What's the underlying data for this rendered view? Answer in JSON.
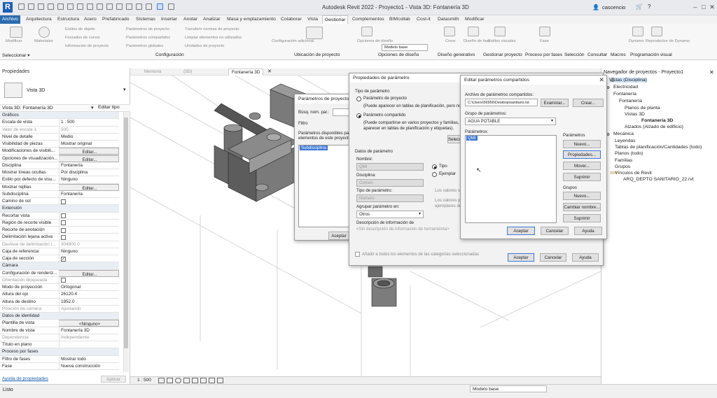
{
  "titlebar": {
    "app_letter": "R",
    "title": "Autodesk Revit 2022 - Proyecto1 - Vista 3D: Fontanería 3D",
    "user": "cascencio"
  },
  "tabs": [
    {
      "label": "Archivo"
    },
    {
      "label": "Arquitectura"
    },
    {
      "label": "Estructura"
    },
    {
      "label": "Acero"
    },
    {
      "label": "Prefabricado"
    },
    {
      "label": "Sistemas"
    },
    {
      "label": "Insertar"
    },
    {
      "label": "Anotar"
    },
    {
      "label": "Analizar"
    },
    {
      "label": "Masa y emplazamiento"
    },
    {
      "label": "Colaborar"
    },
    {
      "label": "Vista"
    },
    {
      "label": "Gestionar"
    },
    {
      "label": "Complementos"
    },
    {
      "label": "BIMcollab"
    },
    {
      "label": "Cost-it"
    },
    {
      "label": "Datasmith"
    },
    {
      "label": "Modificar"
    }
  ],
  "ribbon": {
    "items": [
      "Modificar",
      "Materiales",
      "Estilos de objeto",
      "Forzados de cursor",
      "Información de proyecto",
      "Parámetros de proyecto",
      "Parámetros compartidos",
      "Parámetros globales",
      "Transferir normas de proyecto",
      "Limpiar elementos no utilizados",
      "Unidades de proyecto",
      "Configuración adicional",
      "Opciones de diseño",
      "Modelo base",
      "Crear",
      "Diseño de fase",
      "Editar",
      "Estilos visuales",
      "Fase",
      "Dynamo",
      "Reproductor de Dynamo"
    ],
    "panels": [
      "Seleccionar ▾",
      "Configuración",
      "Ubicación de proyecto",
      "Opciones de diseño",
      "Diseño generativo",
      "Gestionar proyecto",
      "Proceso por fases",
      "Selección",
      "Consultar",
      "Macros",
      "Programación visual"
    ]
  },
  "properties": {
    "title": "Propiedades",
    "type_name": "Vista 3D",
    "selector": "Vista 3D: Fontanería 3D",
    "edit_type": "Editar tipo",
    "rows": [
      {
        "k": "Gráficos",
        "group": true
      },
      {
        "k": "Escala de vista",
        "v": "1 : 500"
      },
      {
        "k": "Valor de escala    1:",
        "v": "500",
        "dim": true
      },
      {
        "k": "Nivel de detalle",
        "v": "Medio"
      },
      {
        "k": "Visibilidad de piezas",
        "v": "Mostrar original"
      },
      {
        "k": "Modificaciones de visibili...",
        "v": "Editar...",
        "btn": true
      },
      {
        "k": "Opciones de visualización...",
        "v": "Editar...",
        "btn": true
      },
      {
        "k": "Disciplina",
        "v": "Fontanería"
      },
      {
        "k": "Mostrar líneas ocultas",
        "v": "Por disciplina"
      },
      {
        "k": "Estilo por defecto de visu...",
        "v": "Ninguno"
      },
      {
        "k": "Mostrar rejillas",
        "v": "Editar...",
        "btn": true
      },
      {
        "k": "Subdisciplina",
        "v": "Fontanería"
      },
      {
        "k": "Camino de sol",
        "chk": true
      },
      {
        "k": "Extensión",
        "group": true
      },
      {
        "k": "Recortar vista",
        "chk": true
      },
      {
        "k": "Región de recorte visible",
        "chk": true
      },
      {
        "k": "Recorte de anotación",
        "chk": true
      },
      {
        "k": "Delimitación lejana activa",
        "chk": true
      },
      {
        "k": "Desfase de delimitación l...",
        "v": "304800.0",
        "dim": true
      },
      {
        "k": "Caja de referencia",
        "v": "Ninguno"
      },
      {
        "k": "Caja de sección",
        "chk": true,
        "checked": true
      },
      {
        "k": "Cámara",
        "group": true
      },
      {
        "k": "Configuración de renderiz...",
        "v": "Editar...",
        "btn": true
      },
      {
        "k": "Orientación bloqueada",
        "chk": true,
        "dim": true
      },
      {
        "k": "Modo de proyección",
        "v": "Ortogonal"
      },
      {
        "k": "Altura del ojo",
        "v": "26120.4"
      },
      {
        "k": "Altura de destino",
        "v": "1952.0"
      },
      {
        "k": "Posición de cámara",
        "v": "Ajustando",
        "dim": true
      },
      {
        "k": "Datos de identidad",
        "group": true
      },
      {
        "k": "Plantilla de vista",
        "v": "<Ninguno>",
        "btn": true
      },
      {
        "k": "Nombre de vista",
        "v": "Fontanería 3D"
      },
      {
        "k": "Dependencia",
        "v": "Independiente",
        "dim": true
      },
      {
        "k": "Título en plano",
        "v": ""
      },
      {
        "k": "Proceso por fases",
        "group": true
      },
      {
        "k": "Filtro de fases",
        "v": "Mostrar todo"
      },
      {
        "k": "Fase",
        "v": "Nueva construcción"
      }
    ],
    "help": "Ayuda de propiedades",
    "apply": "Aplicar"
  },
  "view_tabs": [
    "Memoria",
    "{3D}",
    "Fontanería 3D"
  ],
  "view_bar": {
    "scale": "1 : 500"
  },
  "status": {
    "text": "Listo",
    "model": "Modelo base"
  },
  "browser": {
    "title": "Navegador de proyectos - Proyecto1",
    "items": [
      {
        "label": "Vistas (Disciplina)",
        "sel": true
      },
      {
        "label": "Electricidad"
      },
      {
        "label": "Fontanería"
      },
      {
        "label": "Fontanería"
      },
      {
        "label": "Planos de planta"
      },
      {
        "label": "Vistas 3D"
      },
      {
        "label": "Fontanería 3D",
        "bold": true
      },
      {
        "label": "Alzados (Alzado de edificio)"
      },
      {
        "label": "Mecánica"
      },
      {
        "label": "Leyendas"
      },
      {
        "label": "Tablas de planificación/Cantidades (todo)"
      },
      {
        "label": "Planos (todo)"
      },
      {
        "label": "Familias"
      },
      {
        "label": "Grupos"
      },
      {
        "label": "Vínculos de Revit"
      },
      {
        "label": "ARQ_DEPTO SANITARIO_22.rvt"
      }
    ]
  },
  "dlg_params_project": {
    "title": "Parámetros de proyecto",
    "search_label": "Búsq. nom. par.:",
    "filter": "Filtro",
    "available": "Parámetros disponibles para elementos de este proyecto:",
    "item": "Subdisciplina",
    "select": "Selec",
    "accept": "Aceptar"
  },
  "dlg_param_props": {
    "title": "Propiedades de parámetro",
    "type_group": "Tipo de parámetro",
    "project_param": "Parámetro de proyecto",
    "project_desc": "(Puede aparecer en tablas de planificación, pero no en etiquetas)",
    "shared_param": "Parámetro compartido",
    "shared_desc1": "(Puede compartirse en varios proyectos y familias, exportarse",
    "shared_desc2": "aparecer en tablas de planificación y etiquetas).",
    "select_btn": "Seleccionar...",
    "data_group": "Datos de parámetro",
    "name_label": "Nombre:",
    "name_value": "QMI",
    "discipline_label": "Disciplina:",
    "discipline_value": "Común",
    "type_label": "Tipo de parámetro:",
    "type_value": "Número",
    "group_label": "Agrupar parámetro en:",
    "group_value": "Otros",
    "tipo": "Tipo",
    "ejemplar": "Ejemplar",
    "values_note": "Los valores se",
    "values_note2": "Los valores pu",
    "values_note3": "ejemplares de",
    "tooltip_label": "Descripción de información de",
    "tooltip_value": "<Sin descripción de información de herramienta>",
    "add_all": "Añadir a todos los elementos de las categorías seleccionadas",
    "accept": "Aceptar",
    "cancel": "Cancelar",
    "help": "Ayuda"
  },
  "dlg_shared": {
    "title": "Editar parámetros compartidos",
    "file_label": "Archivo de parámetros compartidos:",
    "file_value": "C:\\Users\\56956\\Desktop\\sanitario.txt",
    "browse": "Examinar...",
    "create": "Crear...",
    "group_label": "Grupo de parámetros:",
    "group_value": "AGUA POTABLE",
    "params_label": "Parámetros:",
    "param_item": "QMI",
    "params_box": "Parámetros",
    "new": "Nuevo...",
    "properties": "Propiedades...",
    "move": "Mover...",
    "delete": "Suprimir",
    "groups_box": "Grupos",
    "g_new": "Nuevo...",
    "g_rename": "Cambiar nombre...",
    "g_delete": "Suprimir",
    "accept": "Aceptar",
    "cancel": "Cancelar",
    "help": "Ayuda"
  },
  "colors": {
    "accent": "#2b6cb0",
    "selection": "#3c78d8",
    "object_fill": "#707070"
  }
}
